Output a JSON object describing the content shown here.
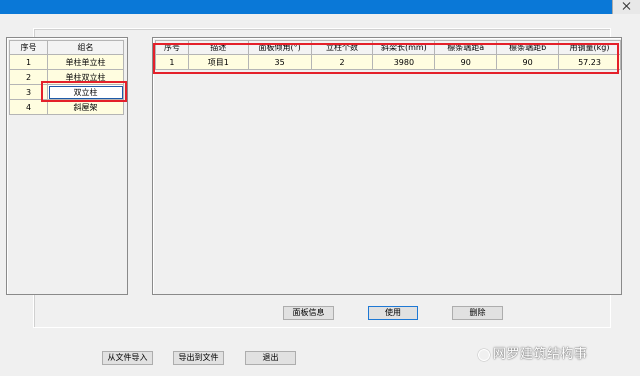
{
  "group_list": {
    "headers": [
      "序号",
      "组名"
    ],
    "rows": [
      {
        "no": "1",
        "name": "单柱单立柱"
      },
      {
        "no": "2",
        "name": "单柱双立柱"
      },
      {
        "no": "3",
        "name": "双立柱"
      },
      {
        "no": "4",
        "name": "斜屋架"
      }
    ]
  },
  "detail_table": {
    "headers": [
      "序号",
      "描述",
      "面板倾角(°)",
      "立柱个数",
      "斜梁长(mm)",
      "檩条端距a",
      "檩条端距b",
      "用钢量(kg)"
    ],
    "rows": [
      [
        "1",
        "项目1",
        "35",
        "2",
        "3980",
        "90",
        "90",
        "57.23"
      ]
    ]
  },
  "buttons": {
    "panel_info": "面板信息",
    "use": "使用",
    "delete": "删除",
    "import": "从文件导入",
    "export": "导出到文件",
    "exit": "退出"
  },
  "watermark": "网罗建筑结构事",
  "colors": {
    "titlebar": "#0a78d7",
    "cell_bg": "#fffde0",
    "highlight": "#e4202a"
  }
}
